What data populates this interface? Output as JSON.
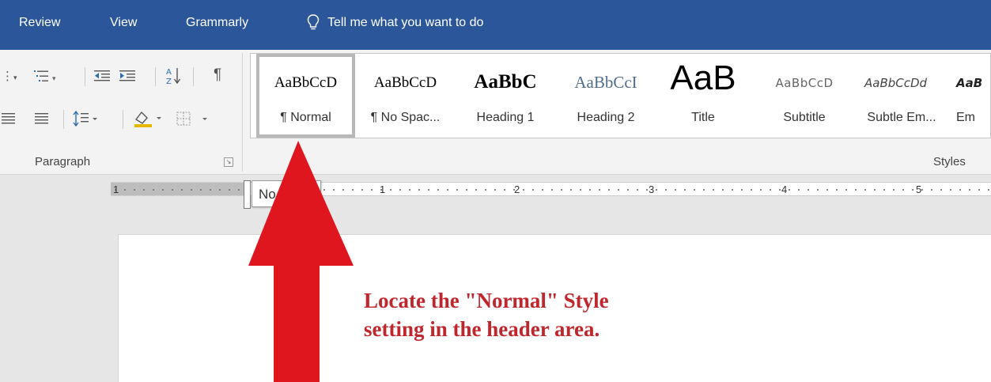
{
  "tabs": {
    "review": "Review",
    "view": "View",
    "grammarly": "Grammarly"
  },
  "tell_me": {
    "text": "Tell me what you want to do",
    "icon": "lightbulb-icon"
  },
  "paragraph_group": {
    "label": "Paragraph",
    "icons": [
      "multilevel-list-icon",
      "decrease-indent-icon",
      "increase-indent-icon",
      "sort-icon",
      "pilcrow-icon",
      "justify-icon",
      "line-spacing-icon",
      "shading-icon",
      "borders-icon",
      "dialog-launcher-icon"
    ]
  },
  "styles_group": {
    "label": "Styles",
    "tiles": [
      {
        "preview": "AaBbCcD",
        "label": "¶ Normal",
        "selected": true
      },
      {
        "preview": "AaBbCcD",
        "label": "¶ No Spac...",
        "selected": false
      },
      {
        "preview": "AaBbC",
        "label": "Heading 1",
        "selected": false
      },
      {
        "preview": "AaBbCcI",
        "label": "Heading 2",
        "selected": false
      },
      {
        "preview": "AaB",
        "label": "Title",
        "selected": false
      },
      {
        "preview": "AaBbCcD",
        "label": "Subtitle",
        "selected": false
      },
      {
        "preview": "AaBbCcDd",
        "label": "Subtle Em...",
        "selected": false
      },
      {
        "preview": "AaB",
        "label": "Em",
        "selected": false
      }
    ]
  },
  "ruler": {
    "numbers": [
      "1",
      "1",
      "2",
      "3",
      "4",
      "5"
    ]
  },
  "tooltip": {
    "text": "No"
  },
  "annotation": {
    "line1": "Locate the \"Normal\" Style",
    "line2": "setting in the header area."
  },
  "colors": {
    "tab_bar": "#2b579a",
    "ribbon": "#f3f3f3",
    "arrow": "#e0161e",
    "annotation_text": "#c0272d"
  }
}
